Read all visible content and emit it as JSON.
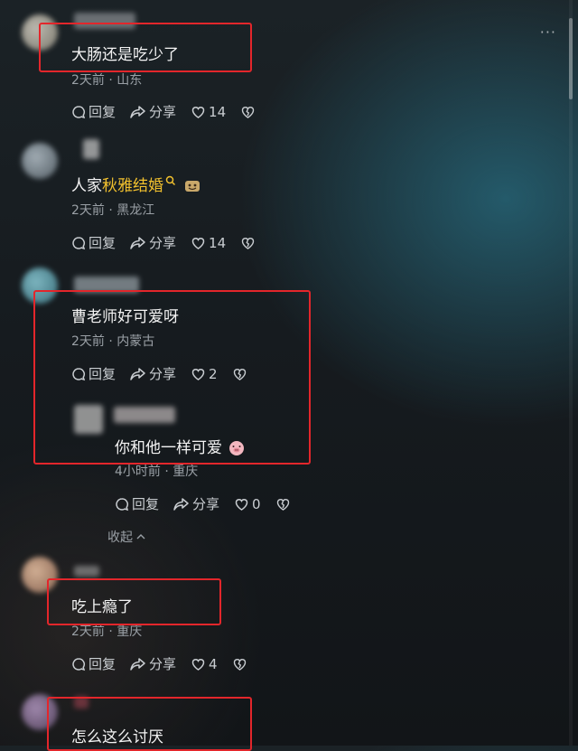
{
  "menu": {
    "more": "···"
  },
  "comments": [
    {
      "text": "大肠还是吃少了",
      "time": "2天前",
      "location": "山东",
      "reply": "回复",
      "share": "分享",
      "likes": "14"
    },
    {
      "text_prefix": "人家",
      "text_highlight": "秋雅结婚",
      "time": "2天前",
      "location": "黑龙江",
      "reply": "回复",
      "share": "分享",
      "likes": "14"
    },
    {
      "text": "曹老师好可爱呀",
      "time": "2天前",
      "location": "内蒙古",
      "reply": "回复",
      "share": "分享",
      "likes": "2"
    },
    {
      "text": "吃上瘾了",
      "time": "2天前",
      "location": "重庆",
      "reply": "回复",
      "share": "分享",
      "likes": "4"
    },
    {
      "text": "怎么这么讨厌"
    }
  ],
  "reply": {
    "text": "你和他一样可爱",
    "time": "4小时前",
    "location": "重庆",
    "reply": "回复",
    "share": "分享",
    "likes": "0"
  },
  "collapse": {
    "label": "收起"
  },
  "colors": {
    "highlight": "#f2c12e",
    "annotation_box": "#e3262b"
  }
}
